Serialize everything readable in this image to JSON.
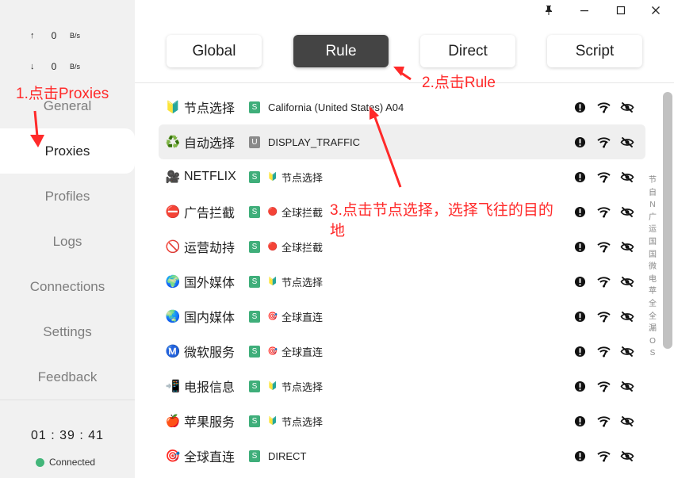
{
  "window": {
    "pin_icon": "pin-icon",
    "min_icon": "minimize-icon",
    "max_icon": "maximize-icon",
    "close_icon": "close-icon"
  },
  "sidebar": {
    "traffic": [
      {
        "arrow": "↑",
        "value": "0",
        "unit": "B/s"
      },
      {
        "arrow": "↓",
        "value": "0",
        "unit": "B/s"
      }
    ],
    "items": [
      {
        "label": "General"
      },
      {
        "label": "Proxies"
      },
      {
        "label": "Profiles"
      },
      {
        "label": "Logs"
      },
      {
        "label": "Connections"
      },
      {
        "label": "Settings"
      },
      {
        "label": "Feedback"
      }
    ],
    "clock": "01 : 39 : 41",
    "status": "Connected",
    "status_color": "#43b67a"
  },
  "modes": [
    {
      "label": "Global"
    },
    {
      "label": "Rule"
    },
    {
      "label": "Direct"
    },
    {
      "label": "Script"
    }
  ],
  "active_mode": "Rule",
  "groups": [
    {
      "icon": "🔰",
      "name": "节点选择",
      "type": "S",
      "sel_icon": "",
      "selected": "California (United States) A04"
    },
    {
      "icon": "♻️",
      "name": "自动选择",
      "type": "U",
      "sel_icon": "",
      "selected": "DISPLAY_TRAFFIC"
    },
    {
      "icon": "🎥",
      "name": "NETFLIX",
      "type": "S",
      "sel_icon": "🔰",
      "selected": "节点选择"
    },
    {
      "icon": "⛔",
      "name": "广告拦截",
      "type": "S",
      "sel_icon": "🔴",
      "selected": "全球拦截"
    },
    {
      "icon": "🚫",
      "name": "运营劫持",
      "type": "S",
      "sel_icon": "🔴",
      "selected": "全球拦截"
    },
    {
      "icon": "🌍",
      "name": "国外媒体",
      "type": "S",
      "sel_icon": "🔰",
      "selected": "节点选择"
    },
    {
      "icon": "🌏",
      "name": "国内媒体",
      "type": "S",
      "sel_icon": "🎯",
      "selected": "全球直连"
    },
    {
      "icon": "Ⓜ️",
      "name": "微软服务",
      "type": "S",
      "sel_icon": "🎯",
      "selected": "全球直连"
    },
    {
      "icon": "📲",
      "name": "电报信息",
      "type": "S",
      "sel_icon": "🔰",
      "selected": "节点选择"
    },
    {
      "icon": "🍎",
      "name": "苹果服务",
      "type": "S",
      "sel_icon": "🔰",
      "selected": "节点选择"
    },
    {
      "icon": "🎯",
      "name": "全球直连",
      "type": "S",
      "sel_icon": "",
      "selected": "DIRECT"
    }
  ],
  "row_icons": [
    "alert-icon",
    "wifi-speed-icon",
    "eye-hidden-icon"
  ],
  "index_letters": [
    "节",
    "自",
    "N",
    "广",
    "运",
    "国",
    "国",
    "微",
    "电",
    "苹",
    "全",
    "全",
    "漏",
    "O",
    "S"
  ],
  "annotations": {
    "step1": "1.点击Proxies",
    "step2": "2.点击Rule",
    "step3_line1": "3.点击节点选择，选择飞往的目的",
    "step3_line2": "地",
    "color": "#ff2a2a"
  }
}
